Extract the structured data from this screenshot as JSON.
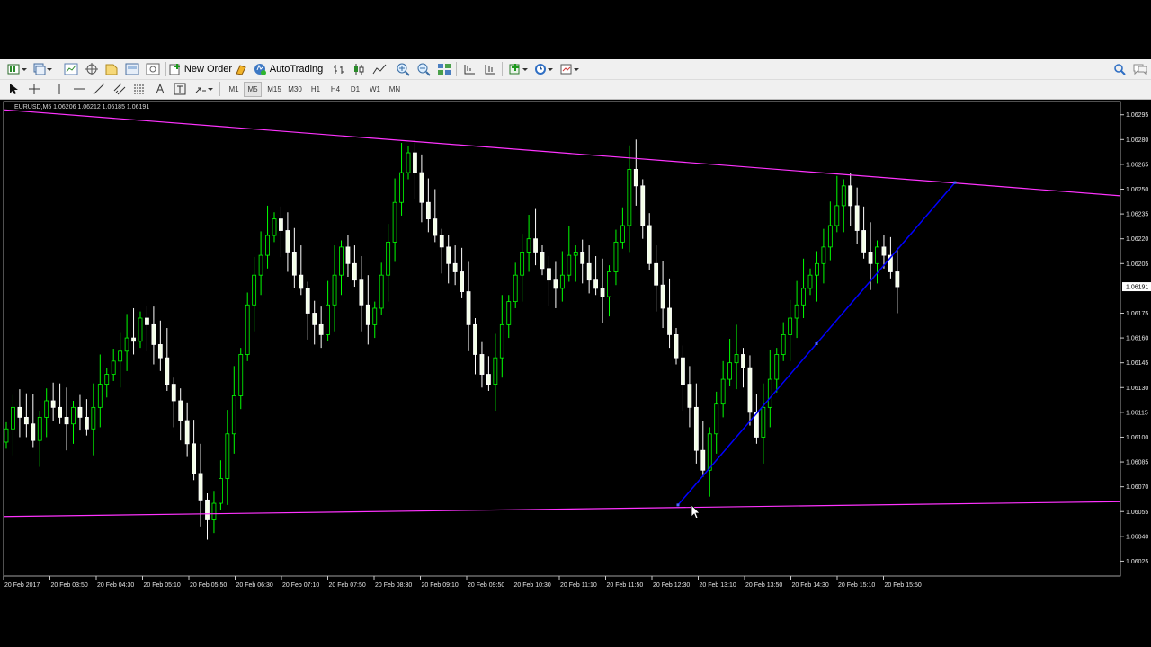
{
  "toolbar": {
    "new_order_label": "New Order",
    "autotrading_label": "AutoTrading",
    "buttons": [
      "new-chart-icon",
      "profiles-icon",
      "market-watch-icon",
      "navigator-icon",
      "data-window-icon",
      "terminal-icon",
      "strategy-tester-icon",
      "metaeditor-icon",
      "zoom-in-icon",
      "zoom-out-icon",
      "tile-windows-icon",
      "chart-shift-icon",
      "autoscroll-icon",
      "indicators-icon",
      "periods-icon",
      "templates-icon",
      "search-icon",
      "chat-icon"
    ]
  },
  "timeframes": {
    "items": [
      "M1",
      "M5",
      "M15",
      "M30",
      "H1",
      "H4",
      "D1",
      "W1",
      "MN"
    ],
    "selected": "M5"
  },
  "chart": {
    "symbol_info": "EURUSD,M5  1.06206 1.06212 1.06185 1.06191",
    "current_price": "1.06191",
    "background": "#000000",
    "bull_color": "#00ff00",
    "bear_color": "#ffffff",
    "trendline_color": "#ff33ff",
    "channel_line_color": "#0000ff"
  },
  "chart_data": {
    "type": "candlestick",
    "symbol": "EURUSD",
    "timeframe": "M5",
    "ohlc_current": {
      "open": 1.06206,
      "high": 1.06212,
      "low": 1.06185,
      "close": 1.06191
    },
    "y_ticks": [
      "1.06295",
      "1.06280",
      "1.06265",
      "1.06250",
      "1.06235",
      "1.06220",
      "1.06205",
      "1.06175",
      "1.06160",
      "1.06145",
      "1.06130",
      "1.06115",
      "1.06100",
      "1.06085",
      "1.06070",
      "1.06055",
      "1.06040",
      "1.06025"
    ],
    "ylim": [
      1.06016,
      1.06303
    ],
    "x_tick_labels": [
      "20 Feb 2017",
      "20 Feb 03:50",
      "20 Feb 04:30",
      "20 Feb 05:10",
      "20 Feb 05:50",
      "20 Feb 06:30",
      "20 Feb 07:10",
      "20 Feb 07:50",
      "20 Feb 08:30",
      "20 Feb 09:10",
      "20 Feb 09:50",
      "20 Feb 10:30",
      "20 Feb 11:10",
      "20 Feb 11:50",
      "20 Feb 12:30",
      "20 Feb 13:10",
      "20 Feb 13:50",
      "20 Feb 14:30",
      "20 Feb 15:10",
      "20 Feb 15:50"
    ],
    "closes": [
      1.06105,
      1.06118,
      1.06112,
      1.06108,
      1.06098,
      1.06112,
      1.06122,
      1.06118,
      1.06112,
      1.06108,
      1.06118,
      1.06112,
      1.06105,
      1.06118,
      1.06132,
      1.06138,
      1.06146,
      1.06152,
      1.0616,
      1.06158,
      1.06172,
      1.06168,
      1.06156,
      1.06148,
      1.06132,
      1.06122,
      1.0611,
      1.06096,
      1.06078,
      1.06062,
      1.0605,
      1.0606,
      1.06075,
      1.06102,
      1.06125,
      1.0615,
      1.0618,
      1.06198,
      1.0621,
      1.06222,
      1.06232,
      1.06225,
      1.06212,
      1.06198,
      1.0619,
      1.06175,
      1.06168,
      1.06162,
      1.0618,
      1.06198,
      1.06215,
      1.06205,
      1.06195,
      1.0618,
      1.06168,
      1.06178,
      1.06198,
      1.06218,
      1.06242,
      1.0626,
      1.06272,
      1.0626,
      1.06242,
      1.06232,
      1.06222,
      1.06215,
      1.06205,
      1.062,
      1.06188,
      1.06168,
      1.0615,
      1.06138,
      1.06132,
      1.06148,
      1.06168,
      1.06182,
      1.06198,
      1.06212,
      1.0622,
      1.06212,
      1.06202,
      1.06195,
      1.0619,
      1.06198,
      1.0621,
      1.06212,
      1.06205,
      1.06195,
      1.0619,
      1.06185,
      1.062,
      1.06218,
      1.06228,
      1.06262,
      1.06252,
      1.06228,
      1.06205,
      1.06192,
      1.06178,
      1.06162,
      1.06148,
      1.06132,
      1.06118,
      1.06092,
      1.0608,
      1.06102,
      1.0612,
      1.06135,
      1.06145,
      1.0615,
      1.06142,
      1.06115,
      1.061,
      1.06118,
      1.06135,
      1.0615,
      1.06162,
      1.06172,
      1.0618,
      1.0619,
      1.06198,
      1.06205,
      1.06215,
      1.06228,
      1.0624,
      1.06252,
      1.0624,
      1.06225,
      1.06212,
      1.06205,
      1.06215,
      1.0621,
      1.062,
      1.06191
    ],
    "annotations": {
      "upper_trendline": {
        "from": [
          "20 Feb 2017",
          1.06298
        ],
        "to": [
          "20 Feb 16:55",
          1.06246
        ]
      },
      "lower_trendline": {
        "from": [
          "20 Feb 2017",
          1.06052
        ],
        "to": [
          "20 Feb 16:55",
          1.06061
        ]
      },
      "channel_line": {
        "from": [
          "20 Feb 12:40",
          1.06059
        ],
        "to": [
          "20 Feb 16:00",
          1.06254
        ]
      }
    }
  }
}
